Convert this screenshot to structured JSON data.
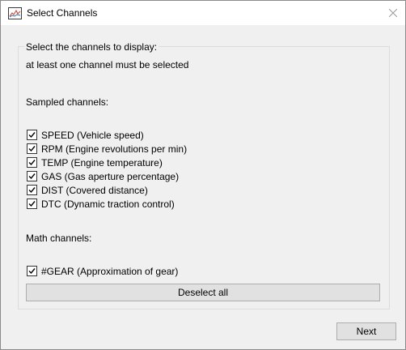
{
  "window": {
    "title": "Select Channels",
    "app_icon": "chart-app-icon",
    "close_icon": "close-icon"
  },
  "group": {
    "legend": "Select the channels to display:",
    "hint": "at least one channel must be selected"
  },
  "sampled": {
    "heading": "Sampled channels:",
    "items": [
      {
        "label": "SPEED (Vehicle speed)",
        "checked": true
      },
      {
        "label": "RPM (Engine revolutions per min)",
        "checked": true
      },
      {
        "label": "TEMP (Engine temperature)",
        "checked": true
      },
      {
        "label": "GAS (Gas aperture percentage)",
        "checked": true
      },
      {
        "label": "DIST (Covered distance)",
        "checked": true
      },
      {
        "label": "DTC (Dynamic traction control)",
        "checked": true
      }
    ]
  },
  "math": {
    "heading": "Math channels:",
    "items": [
      {
        "label": "#GEAR  (Approximation of gear)",
        "checked": true
      }
    ]
  },
  "buttons": {
    "deselect_all": "Deselect all",
    "next": "Next"
  }
}
